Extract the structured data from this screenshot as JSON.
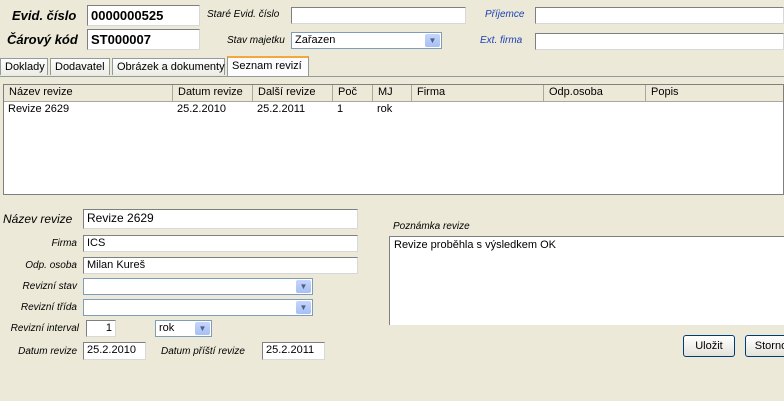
{
  "header": {
    "evid_cislo_label": "Evid. číslo",
    "evid_cislo_value": "0000000525",
    "carovy_kod_label": "Čárový kód",
    "carovy_kod_value": "ST000007",
    "stare_evid_label": "Staré Evid. číslo",
    "stare_evid_value": "",
    "stav_majetku_label": "Stav majetku",
    "stav_majetku_value": "Zařazen",
    "prijemce_label": "Příjemce",
    "prijemce_value": "",
    "ext_firma_label": "Ext. firma",
    "ext_firma_value": ""
  },
  "tabs": [
    {
      "label": "Doklady",
      "active": false
    },
    {
      "label": "Dodavatel",
      "active": false
    },
    {
      "label": "Obrázek a dokumenty",
      "active": false
    },
    {
      "label": "Seznam revizí",
      "active": true
    }
  ],
  "grid": {
    "columns": [
      "Název revize",
      "Datum revize",
      "Další revize",
      "Poč",
      "MJ",
      "Firma",
      "Odp.osoba",
      "Popis"
    ],
    "rows": [
      [
        "Revize 2629",
        "25.2.2010",
        "25.2.2011",
        "1",
        "rok",
        "",
        "",
        ""
      ]
    ]
  },
  "detail": {
    "nazev_revize_label": "Název revize",
    "nazev_revize_value": "Revize 2629",
    "firma_label": "Firma",
    "firma_value": "ICS",
    "odp_osoba_label": "Odp. osoba",
    "odp_osoba_value": "Milan Kureš",
    "revizni_stav_label": "Revizní stav",
    "revizni_stav_value": "",
    "revizni_trida_label": "Revizní třída",
    "revizni_trida_value": "",
    "revizni_interval_label": "Revizní interval",
    "revizni_interval_value": "1",
    "revizni_interval_unit": "rok",
    "datum_revize_label": "Datum revize",
    "datum_revize_value": "25.2.2010",
    "datum_pristi_label": "Datum příští revize",
    "datum_pristi_value": "25.2.2011",
    "poznamka_label": "Poznámka revize",
    "poznamka_value": "Revize proběhla s výsledkem OK"
  },
  "buttons": {
    "ulozit": "Uložit",
    "storno": "Storno"
  }
}
